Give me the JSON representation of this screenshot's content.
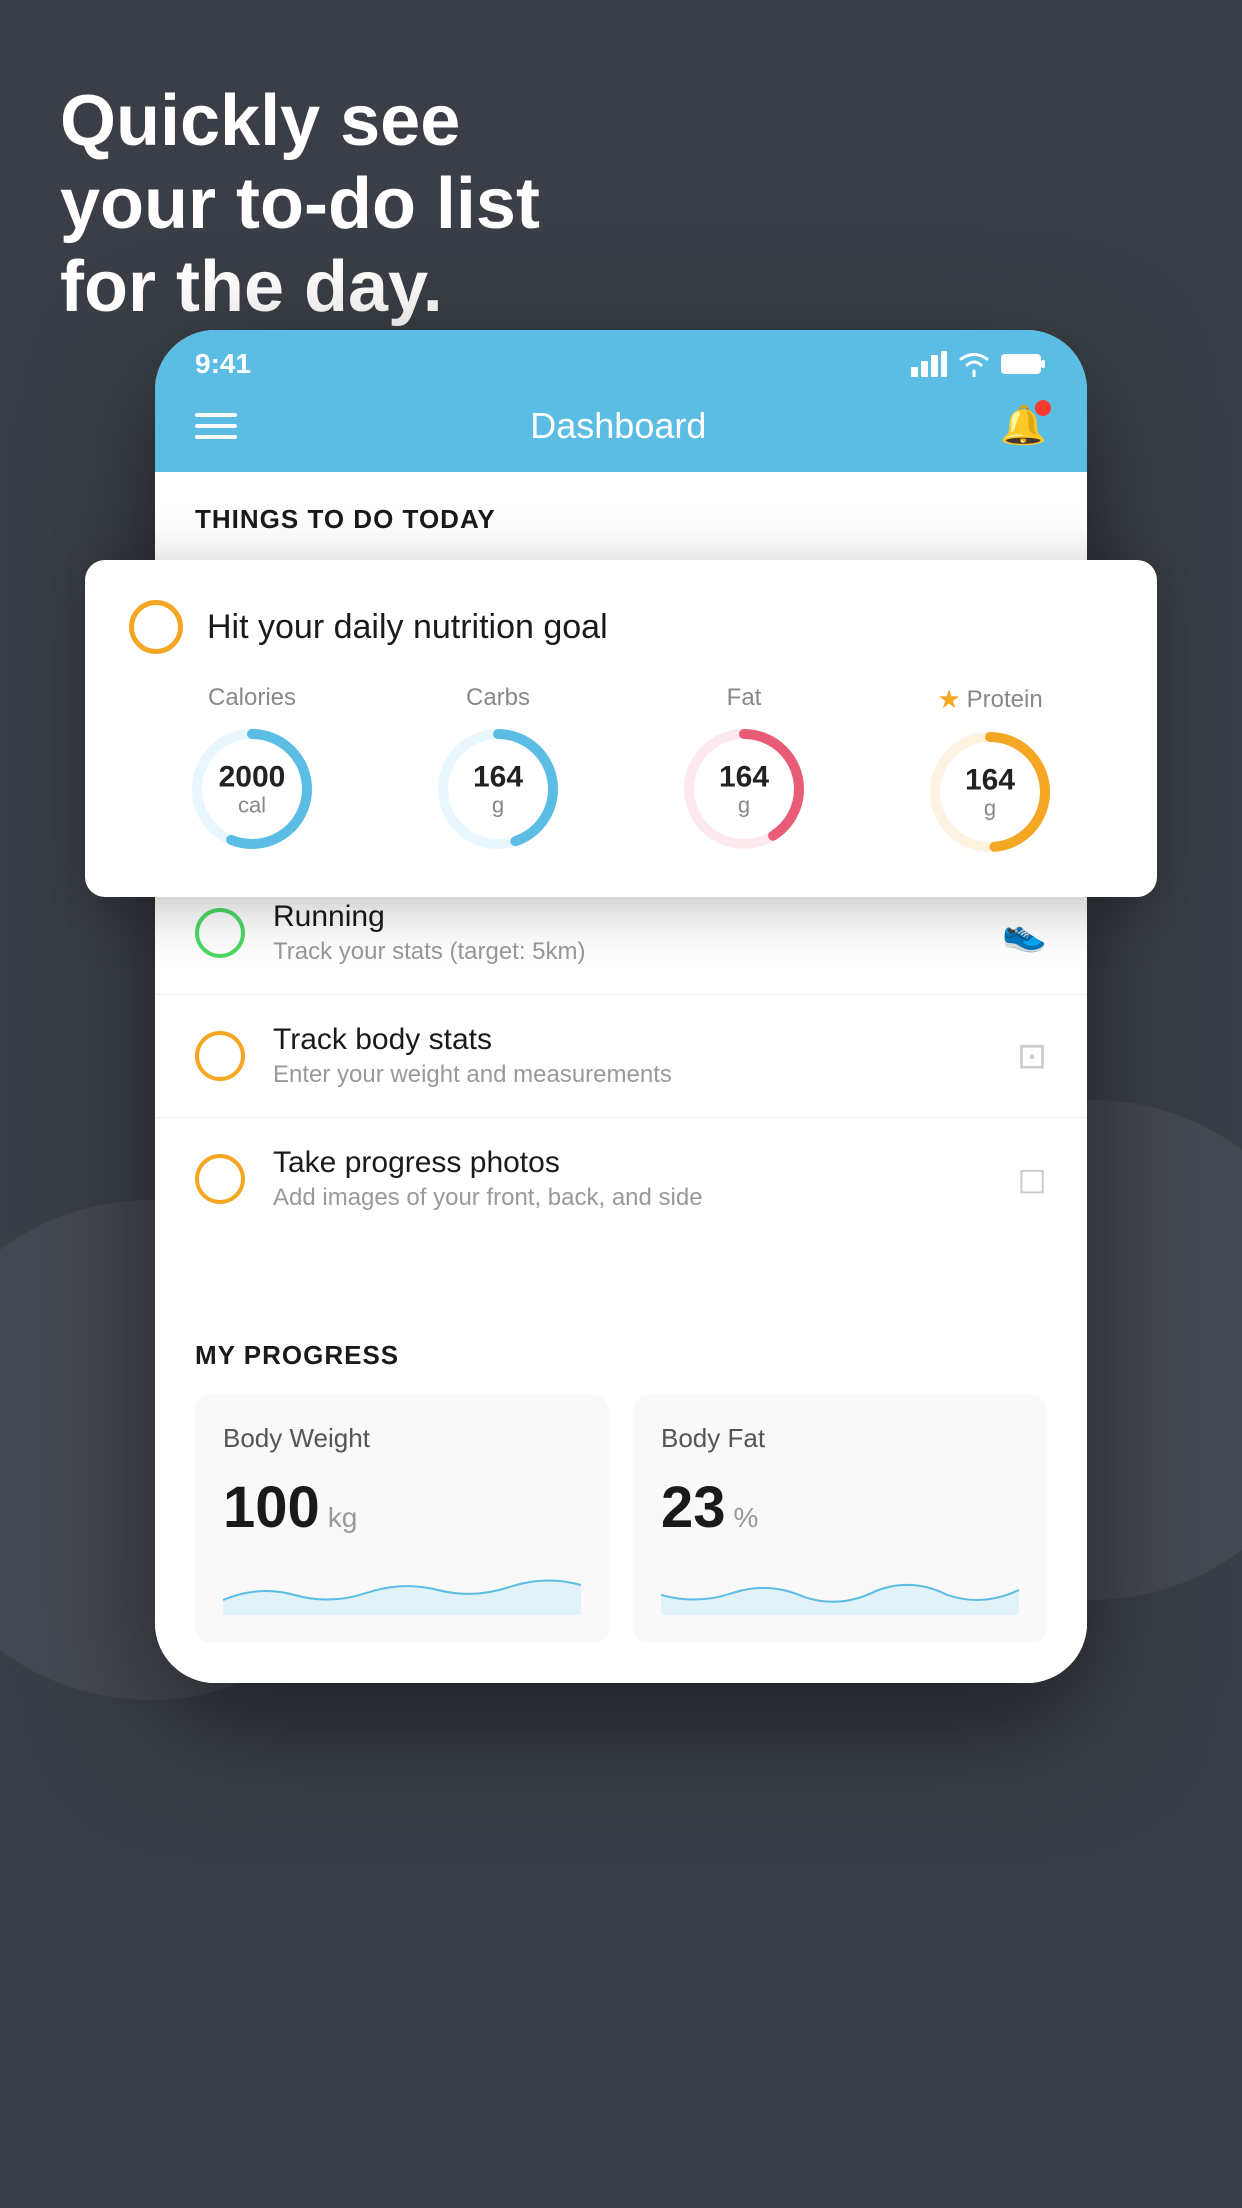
{
  "headline": {
    "line1": "Quickly see",
    "line2": "your to-do list",
    "line3": "for the day."
  },
  "status_bar": {
    "time": "9:41"
  },
  "nav": {
    "title": "Dashboard"
  },
  "section": {
    "things_today": "THINGS TO DO TODAY"
  },
  "floating_card": {
    "title": "Hit your daily nutrition goal",
    "nutrition": [
      {
        "label": "Calories",
        "value": "2000",
        "unit": "cal",
        "color": "#5bbde4",
        "track": 75
      },
      {
        "label": "Carbs",
        "value": "164",
        "unit": "g",
        "color": "#5bbde4",
        "track": 60
      },
      {
        "label": "Fat",
        "value": "164",
        "unit": "g",
        "color": "#e85d75",
        "track": 55
      },
      {
        "label": "Protein",
        "value": "164",
        "unit": "g",
        "color": "#f5a623",
        "track": 65,
        "star": true
      }
    ]
  },
  "todo_items": [
    {
      "title": "Running",
      "subtitle": "Track your stats (target: 5km)",
      "circle_color": "green",
      "icon": "👟"
    },
    {
      "title": "Track body stats",
      "subtitle": "Enter your weight and measurements",
      "circle_color": "yellow",
      "icon": "⚖️"
    },
    {
      "title": "Take progress photos",
      "subtitle": "Add images of your front, back, and side",
      "circle_color": "yellow",
      "icon": "🖼️"
    }
  ],
  "progress": {
    "header": "MY PROGRESS",
    "cards": [
      {
        "title": "Body Weight",
        "value": "100",
        "unit": "kg"
      },
      {
        "title": "Body Fat",
        "value": "23",
        "unit": "%"
      }
    ]
  }
}
